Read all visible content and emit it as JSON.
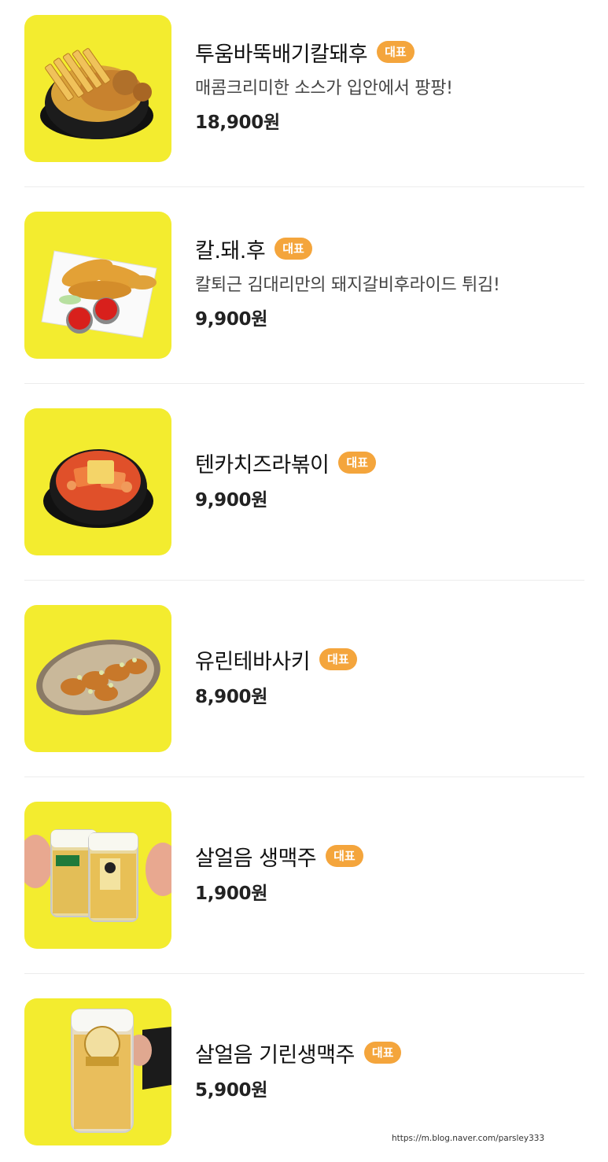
{
  "menu": {
    "items": [
      {
        "name": "투움바뚝배기칼돼후",
        "badge": "대표",
        "description": "매콤크리미한 소스가 입안에서 팡팡!",
        "price": "18,900원",
        "image": "tuumba-ttukbaegi-photo"
      },
      {
        "name": "칼.돼.후",
        "badge": "대표",
        "description": "칼퇴근 김대리만의 돼지갈비후라이드 튀김!",
        "price": "9,900원",
        "image": "fried-pork-rib-photo"
      },
      {
        "name": "텐카치즈라볶이",
        "badge": "대표",
        "description": "",
        "price": "9,900원",
        "image": "cheese-rabokki-photo"
      },
      {
        "name": "유린테바사키",
        "badge": "대표",
        "description": "",
        "price": "8,900원",
        "image": "yurin-tebasaki-photo"
      },
      {
        "name": "살얼음 생맥주",
        "badge": "대표",
        "description": "",
        "price": "1,900원",
        "image": "draft-beer-photo"
      },
      {
        "name": "살얼음 기린생맥주",
        "badge": "대표",
        "description": "",
        "price": "5,900원",
        "image": "kirin-draft-beer-photo"
      }
    ]
  },
  "watermark": "https://m.blog.naver.com/parsley333",
  "colors": {
    "thumb_bg": "#f3ec2f",
    "badge_bg": "#f4a53c",
    "divider": "#ececec"
  }
}
